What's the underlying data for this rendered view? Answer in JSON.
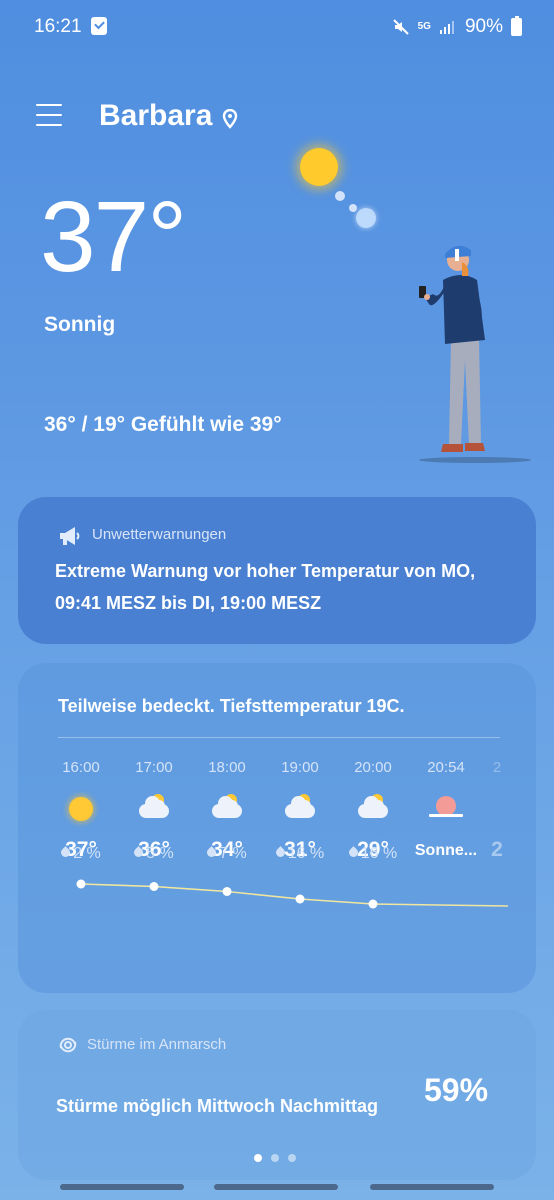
{
  "status_bar": {
    "time": "16:21",
    "network": "5G",
    "battery": "90%"
  },
  "header": {
    "city": "Barbara"
  },
  "current": {
    "temperature": "37°",
    "condition": "Sonnig",
    "hi_lo_feels": "36° / 19° Gefühlt wie 39°"
  },
  "warning_card": {
    "title": "Unwetterwarnungen",
    "message": "Extreme Warnung vor hoher Temperatur von MO, 09:41 MESZ bis DI, 19:00 MESZ"
  },
  "forecast_card": {
    "summary": "Teilweise bedeckt. Tiefsttemperatur 19C.",
    "hours": [
      {
        "time": "16:00",
        "icon": "sun-icon",
        "temp": "37°",
        "precip": "2 %"
      },
      {
        "time": "17:00",
        "icon": "partly-cloudy-icon",
        "temp": "36°",
        "precip": "5 %"
      },
      {
        "time": "18:00",
        "icon": "partly-cloudy-icon",
        "temp": "34°",
        "precip": "7 %"
      },
      {
        "time": "19:00",
        "icon": "partly-cloudy-icon",
        "temp": "31°",
        "precip": "16 %"
      },
      {
        "time": "20:00",
        "icon": "partly-cloudy-icon",
        "temp": "29°",
        "precip": "16 %"
      },
      {
        "time": "20:54",
        "icon": "sunset-icon",
        "temp": "Sonne...",
        "precip": ""
      },
      {
        "time": "2",
        "icon": "partly-cloudy-icon",
        "temp": "2",
        "precip": ""
      }
    ],
    "trend_values": [
      37,
      36,
      34,
      31,
      29
    ]
  },
  "storm_card": {
    "title": "Stürme im Anmarsch",
    "message": "Stürme möglich Mittwoch Nachmittag",
    "percent": "59%"
  },
  "pager": {
    "pages": 3,
    "active": 1
  },
  "colors": {
    "sun": "#ffc835",
    "sunset": "#f39b96",
    "trend_line": "#f0e6a0",
    "warning_card": "#4a80d2"
  }
}
